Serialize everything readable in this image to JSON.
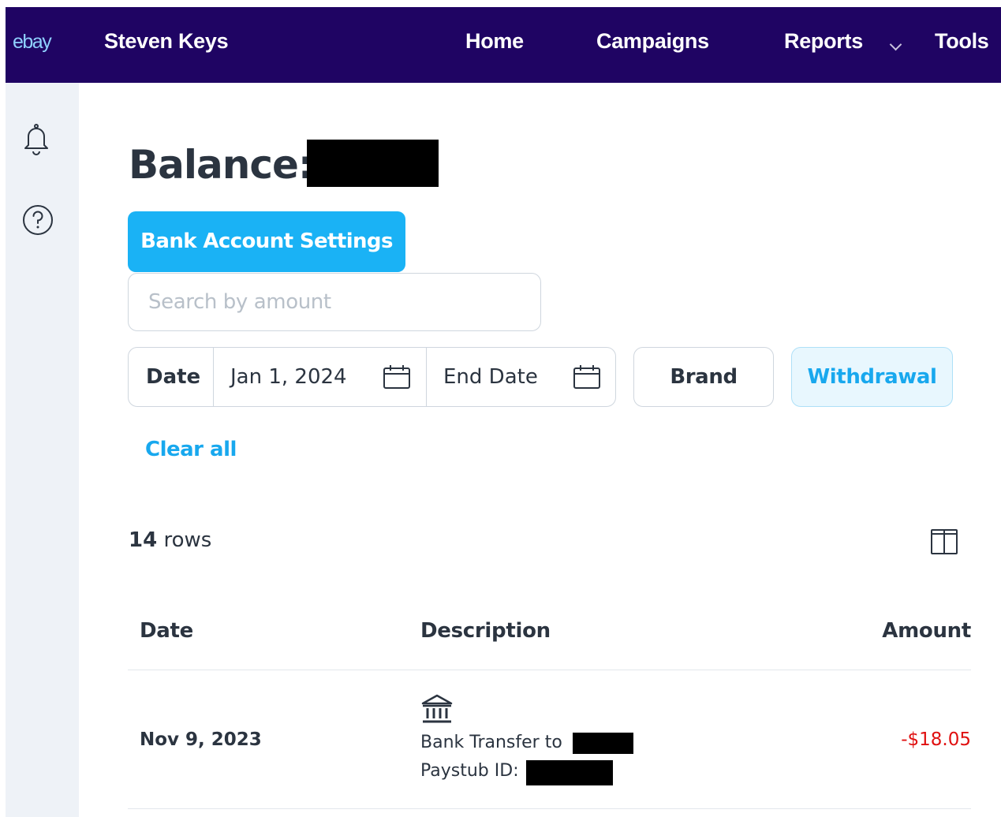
{
  "topbar": {
    "logo": "ebay",
    "user_name": "Steven Keys",
    "nav": [
      "Home",
      "Campaigns",
      "Reports",
      "Tools"
    ]
  },
  "sidebar": {
    "icons": [
      "bell-icon",
      "help-icon"
    ]
  },
  "page": {
    "balance_label": "Balance:",
    "bank_settings_label": "Bank Account Settings",
    "search_placeholder": "Search by amount"
  },
  "filters": {
    "date_label": "Date",
    "start_date": "Jan 1, 2024",
    "end_date_placeholder": "End Date",
    "brand_label": "Brand",
    "withdrawal_label": "Withdrawal",
    "clear_all_label": "Clear all"
  },
  "table": {
    "row_count": "14",
    "row_count_suffix": "rows",
    "headers": [
      "Date",
      "Description",
      "Amount"
    ],
    "rows": [
      {
        "date": "Nov 9, 2023",
        "description_line1": "Bank Transfer to",
        "description_line2": "Paystub ID:",
        "amount": "-$18.05"
      }
    ]
  },
  "colors": {
    "topbar": "#1f0463",
    "primary": "#1ab2f5",
    "accent_text": "#18a8ee",
    "negative_amount": "#e01010",
    "sidebar_bg": "#eef2f7"
  }
}
